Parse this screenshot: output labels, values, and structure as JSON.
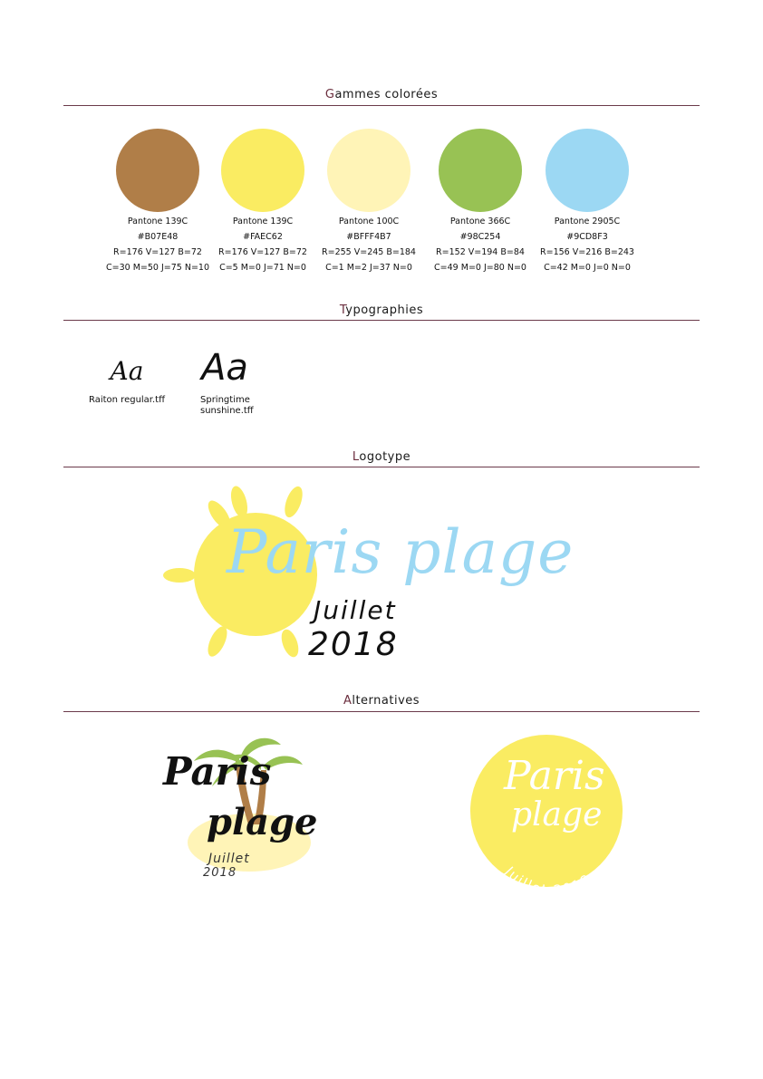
{
  "sections": {
    "colors": {
      "initial": "G",
      "rest": "ammes colorées"
    },
    "typography": {
      "initial": "T",
      "rest": "ypographies"
    },
    "logotype": {
      "initial": "L",
      "rest": "ogotype"
    },
    "alternatives": {
      "initial": "A",
      "rest": "lternatives"
    }
  },
  "swatches": [
    {
      "color": "#B07E48",
      "pantone": "Pantone 139C",
      "hex": "#B07E48",
      "rgb": "R=176 V=127 B=72",
      "cmyk": "C=30 M=50 J=75 N=10"
    },
    {
      "color": "#FAEC62",
      "pantone": "Pantone 139C",
      "hex": "#FAEC62",
      "rgb": "R=176 V=127 B=72",
      "cmyk": "C=5 M=0 J=71 N=0"
    },
    {
      "color": "#FFF4B7",
      "pantone": "Pantone 100C",
      "hex": "#BFFF4B7",
      "rgb": "R=255 V=245 B=184",
      "cmyk": "C=1 M=2 J=37 N=0"
    },
    {
      "color": "#98C254",
      "pantone": "Pantone 366C",
      "hex": "#98C254",
      "rgb": "R=152 V=194 B=84",
      "cmyk": "C=49 M=0 J=80 N=0"
    },
    {
      "color": "#9CD8F3",
      "pantone": "Pantone 2905C",
      "hex": "#9CD8F3",
      "rgb": "R=156 V=216 B=243",
      "cmyk": "C=42 M=0 J=0 N=0"
    }
  ],
  "fonts": [
    {
      "sample": "Aa",
      "caption_1": "Raiton regular.tff",
      "caption_2": ""
    },
    {
      "sample": "Aa",
      "caption_1": "Springtime",
      "caption_2": "sunshine.tff"
    }
  ],
  "logo": {
    "brand": "Paris plage",
    "month": "Juillet",
    "year": "2018",
    "sun_color": "#FAEC62",
    "brand_color": "#9CD8F3"
  },
  "alt_logo_1": {
    "line_1": "Paris",
    "line_2": "plage",
    "month": "Juillet",
    "year": "2018"
  },
  "alt_logo_2": {
    "line_1": "Paris",
    "line_2": "plage",
    "arc_text": "Juillet 2018"
  }
}
